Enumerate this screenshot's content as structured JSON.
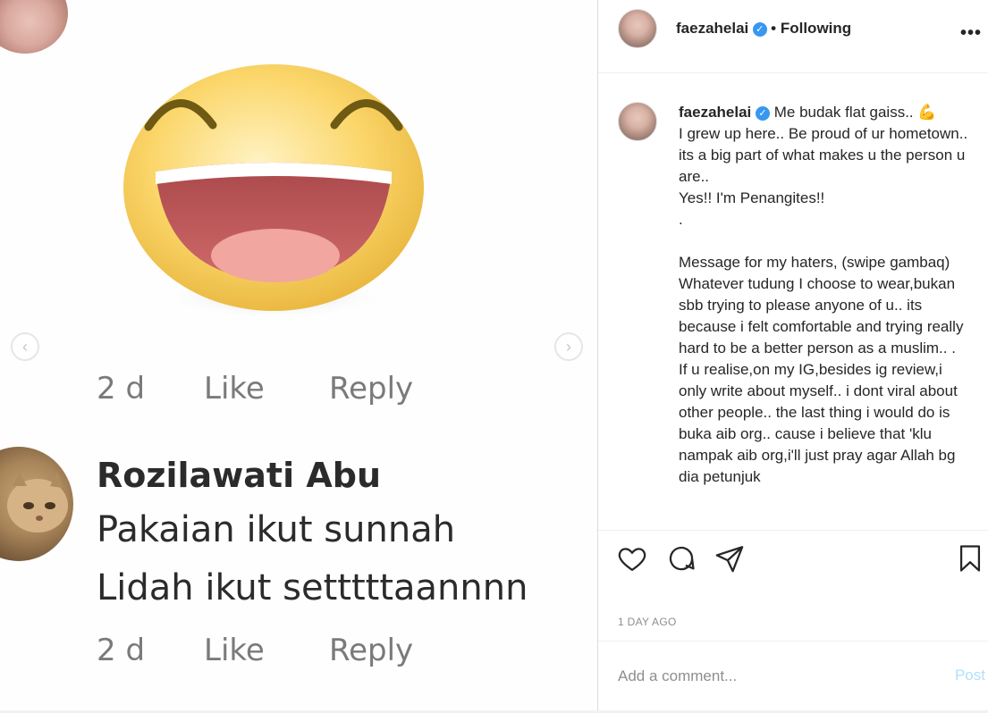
{
  "post": {
    "username": "faezahelai",
    "follow_status": "• Following",
    "more_icon": "more-horizontal-icon",
    "caption_first_line": "Me budak flat gaiss..",
    "caption_emoji": "💪",
    "caption_body": "I grew up here.. Be proud of ur hometown.. its a big part of what makes u the person u are..\nYes!! I'm Penangites!!\n.\n\nMessage for my haters, (swipe gambaq)\nWhatever tudung I choose to wear,bukan sbb trying to please anyone of u.. its because i felt comfortable and trying really hard to be a better person as a muslim.. .\nIf u realise,on my IG,besides ig review,i only write about myself.. i dont viral about other people.. the last thing i would do is buka aib org.. cause i believe that 'klu nampak aib org,i'll just pray agar Allah bg dia petunjuk",
    "timestamp": "1 DAY AGO",
    "comment_placeholder": "Add a comment...",
    "post_button": "Post",
    "accent_color": "#3897f0",
    "post_button_color": "#b2dffc"
  },
  "media": {
    "comment1": {
      "time": "2 d",
      "like": "Like",
      "reply": "Reply"
    },
    "comment2": {
      "name": "Rozilawati Abu",
      "line1": "Pakaian ikut sunnah",
      "line2": "Lidah ikut setttttaannnn",
      "time": "2 d",
      "like": "Like",
      "reply": "Reply"
    },
    "prev_icon": "chevron-left-icon",
    "next_icon": "chevron-right-icon"
  }
}
